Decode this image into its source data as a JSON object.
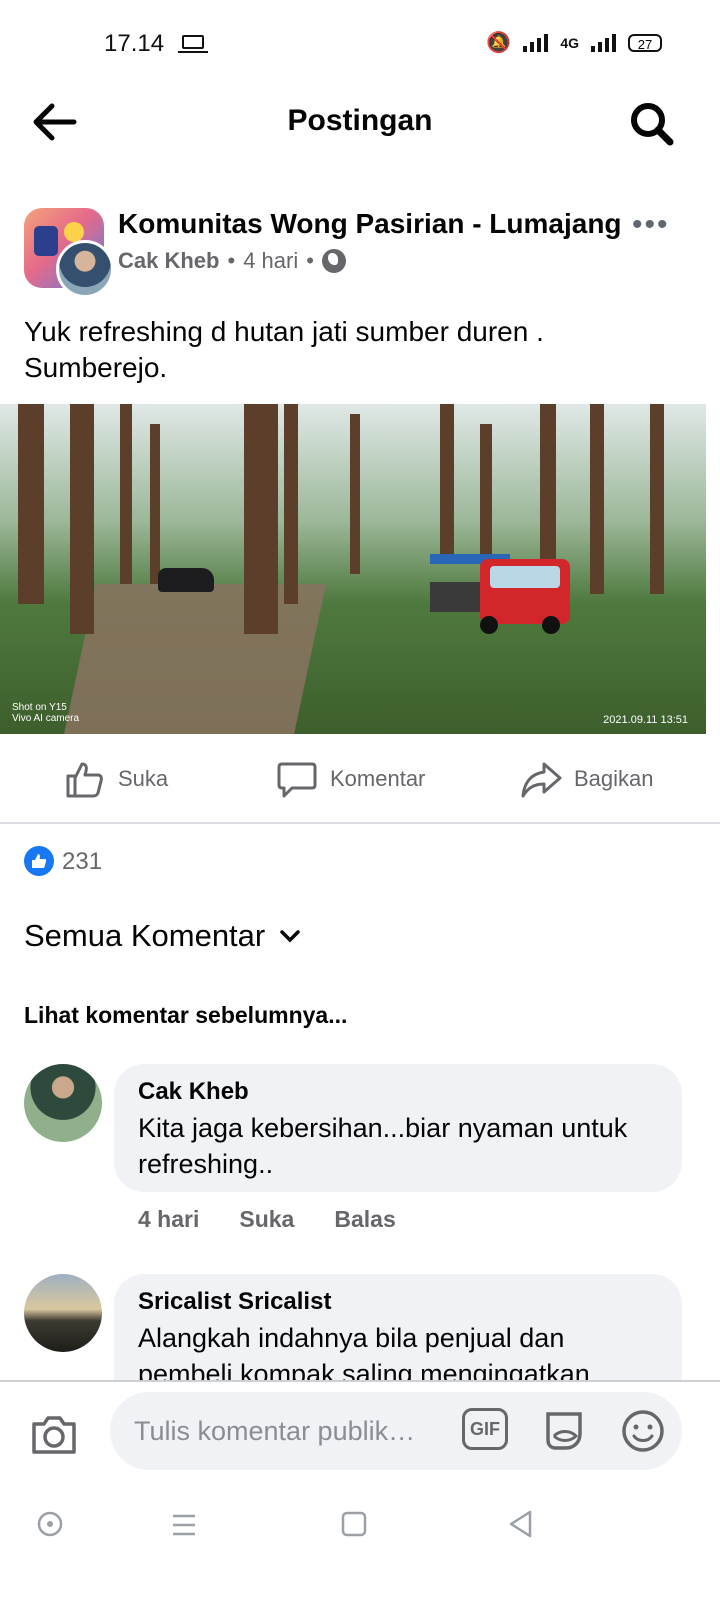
{
  "status": {
    "time": "17.14",
    "network": "4G",
    "battery": "27"
  },
  "header": {
    "title": "Postingan"
  },
  "post": {
    "group_name": "Komunitas Wong Pasirian - Lumajang",
    "author": "Cak Kheb",
    "age": "4 hari",
    "text": "Yuk refreshing d hutan jati sumber duren . Sumberejo.",
    "photo_watermark_line1": "Shot on Y15",
    "photo_watermark_line2": "Vivo AI camera",
    "photo_timestamp": "2021.09.11 13:51",
    "like_count": "231"
  },
  "actions": {
    "like": "Suka",
    "comment": "Komentar",
    "share": "Bagikan"
  },
  "comments_section": {
    "sort_label": "Semua Komentar",
    "previous_label": "Lihat komentar sebelumnya...",
    "items": [
      {
        "name": "Cak Kheb",
        "text": "Kita jaga kebersihan...biar nyaman untuk refreshing..",
        "age": "4 hari",
        "like": "Suka",
        "reply": "Balas"
      },
      {
        "name": "Sricalist Sricalist",
        "text": "Alangkah indahnya bila penjual dan pembeli kompak saling mengingatkan"
      }
    ]
  },
  "composer": {
    "placeholder": "Tulis komentar publik…",
    "gif_label": "GIF"
  },
  "colors": {
    "accent": "#1877f2",
    "bubble": "#f0f2f5",
    "secondary_text": "#65676b"
  }
}
